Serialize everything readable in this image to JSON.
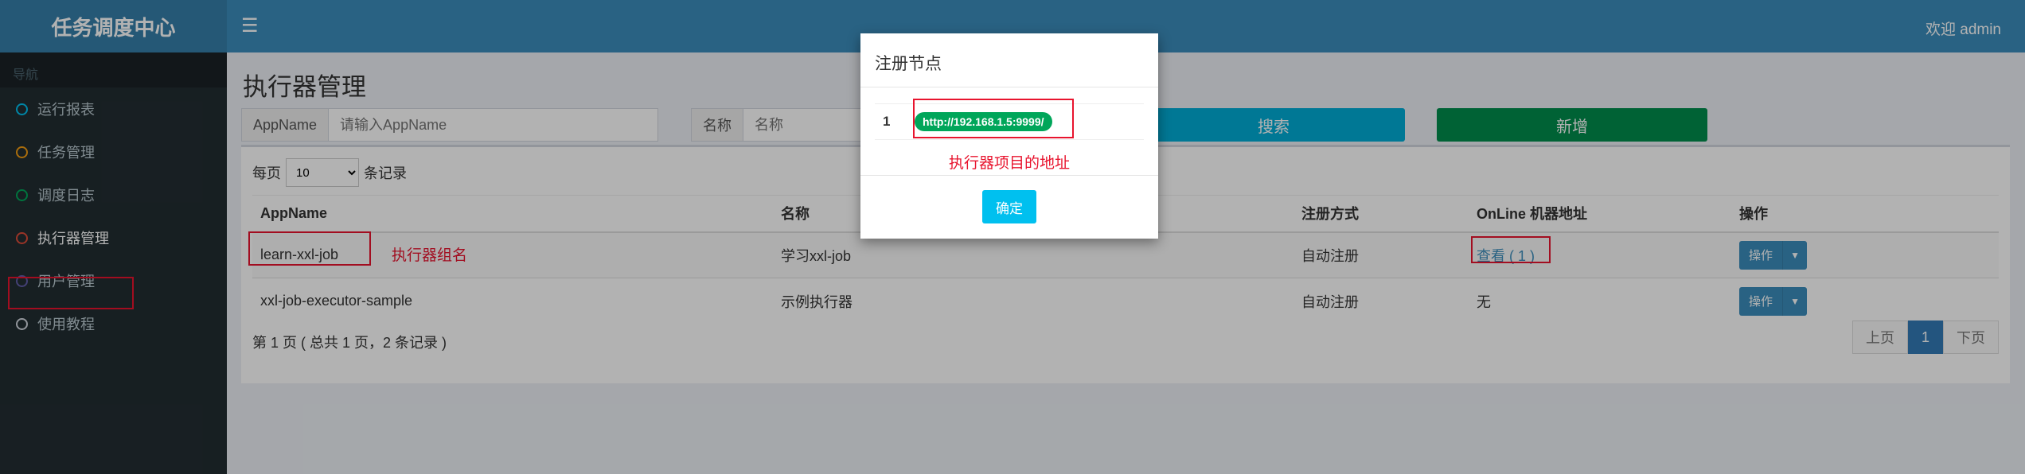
{
  "app": {
    "title": "任务调度中心",
    "welcome": "欢迎 admin",
    "menu_icon": "hamburger-icon"
  },
  "sidebar": {
    "header": "导航",
    "items": [
      {
        "label": "运行报表",
        "color": "#00c0ef"
      },
      {
        "label": "任务管理",
        "color": "#f39c12"
      },
      {
        "label": "调度日志",
        "color": "#00a65a"
      },
      {
        "label": "执行器管理",
        "color": "#dd4b39"
      },
      {
        "label": "用户管理",
        "color": "#605ca8"
      },
      {
        "label": "使用教程",
        "color": "#d2d6de"
      }
    ]
  },
  "main": {
    "title": "执行器管理",
    "filter": {
      "appname_label": "AppName",
      "appname_placeholder": "请输入AppName",
      "name_label": "名称",
      "name_placeholder": "名称",
      "search_label": "搜索",
      "add_label": "新增"
    },
    "per_page_prefix": "每页",
    "per_page_value": "10",
    "per_page_suffix": "条记录",
    "table": {
      "headers": [
        "AppName",
        "名称",
        "注册方式",
        "OnLine 机器地址",
        "操作"
      ],
      "rows": [
        {
          "appname": "learn-xxl-job",
          "name": "学习xxl-job",
          "reg": "自动注册",
          "online": "查看 ( 1 )",
          "op": "操作"
        },
        {
          "appname": "xxl-job-executor-sample",
          "name": "示例执行器",
          "reg": "自动注册",
          "online": "无",
          "op": "操作"
        }
      ]
    },
    "page_info": "第 1 页 ( 总共 1 页，2 条记录 )",
    "pager": {
      "prev": "上页",
      "current": "1",
      "next": "下页"
    }
  },
  "modal": {
    "title": "注册节点",
    "index": "1",
    "address": "http://192.168.1.5:9999/",
    "note": "执行器项目的地址",
    "ok_label": "确定"
  },
  "annotations": {
    "group_name": "执行器组名"
  }
}
